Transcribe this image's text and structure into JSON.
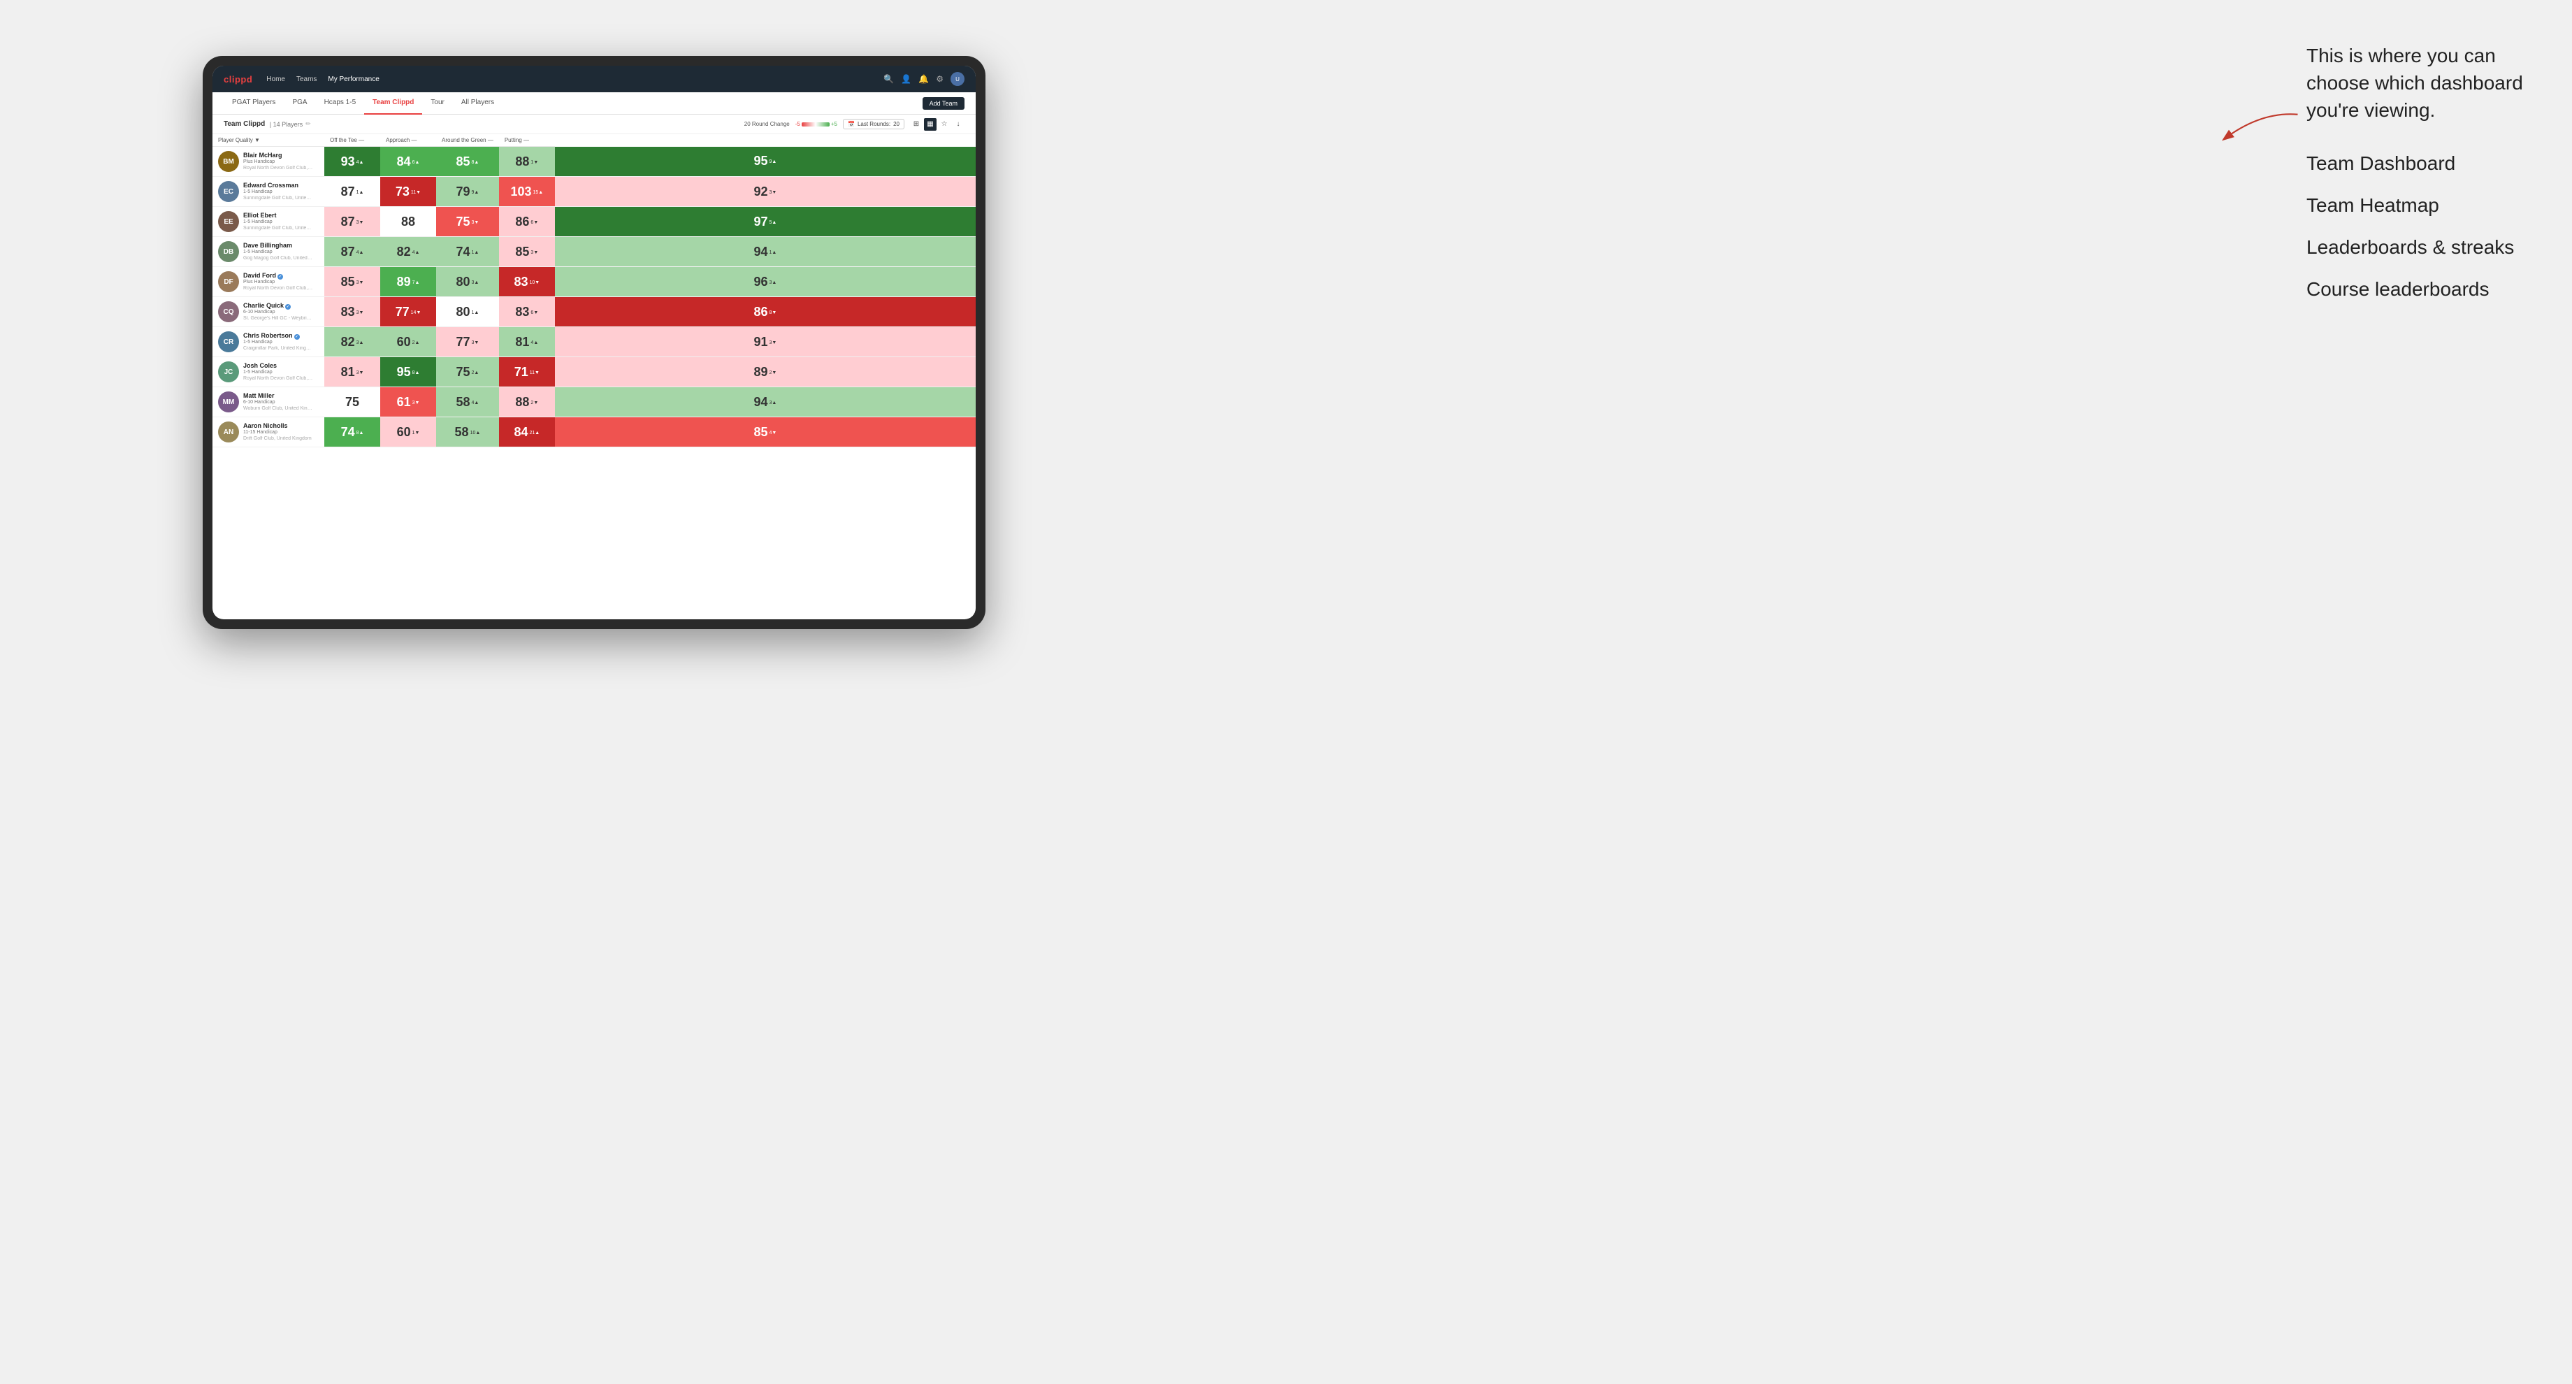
{
  "annotation": {
    "intro": "This is where you can choose which dashboard you're viewing.",
    "items": [
      "Team Dashboard",
      "Team Heatmap",
      "Leaderboards & streaks",
      "Course leaderboards"
    ]
  },
  "nav": {
    "logo": "clippd",
    "links": [
      "Home",
      "Teams",
      "My Performance"
    ],
    "active_link": "My Performance"
  },
  "tabs": {
    "items": [
      "PGAT Players",
      "PGA",
      "Hcaps 1-5",
      "Team Clippd",
      "Tour",
      "All Players"
    ],
    "active": "Team Clippd",
    "add_team_label": "Add Team"
  },
  "toolbar": {
    "team_name": "Team Clippd",
    "separator": "|",
    "player_count": "14 Players",
    "round_change_label": "20 Round Change",
    "scale_neg": "-5",
    "scale_pos": "+5",
    "last_rounds_label": "Last Rounds:",
    "last_rounds_value": "20"
  },
  "table": {
    "headers": {
      "player": "Player Quality ▼",
      "off_tee": "Off the Tee —",
      "approach": "Approach —",
      "around_green": "Around the Green —",
      "putting": "Putting —"
    },
    "rows": [
      {
        "name": "Blair McHarg",
        "handicap": "Plus Handicap",
        "club": "Royal North Devon Golf Club, United Kingdom",
        "avatar_color": "#8B6914",
        "initials": "BM",
        "scores": {
          "quality": {
            "val": 93,
            "change": "4▲",
            "bg": "green-dark"
          },
          "off_tee": {
            "val": 84,
            "change": "6▲",
            "bg": "green-med"
          },
          "approach": {
            "val": 85,
            "change": "8▲",
            "bg": "green-med"
          },
          "around": {
            "val": 88,
            "change": "1▼",
            "bg": "green-light"
          },
          "putting": {
            "val": 95,
            "change": "9▲",
            "bg": "green-dark"
          }
        }
      },
      {
        "name": "Edward Crossman",
        "handicap": "1-5 Handicap",
        "club": "Sunningdale Golf Club, United Kingdom",
        "avatar_color": "#5a7a9a",
        "initials": "EC",
        "scores": {
          "quality": {
            "val": 87,
            "change": "1▲",
            "bg": "white"
          },
          "off_tee": {
            "val": 73,
            "change": "11▼",
            "bg": "red-dark"
          },
          "approach": {
            "val": 79,
            "change": "9▲",
            "bg": "green-light"
          },
          "around": {
            "val": 103,
            "change": "15▲",
            "bg": "red-med"
          },
          "putting": {
            "val": 92,
            "change": "3▼",
            "bg": "red-light"
          }
        }
      },
      {
        "name": "Elliot Ebert",
        "handicap": "1-5 Handicap",
        "club": "Sunningdale Golf Club, United Kingdom",
        "avatar_color": "#7a5a4a",
        "initials": "EE",
        "scores": {
          "quality": {
            "val": 87,
            "change": "3▼",
            "bg": "red-light"
          },
          "off_tee": {
            "val": 88,
            "change": "",
            "bg": "white"
          },
          "approach": {
            "val": 75,
            "change": "3▼",
            "bg": "red-med"
          },
          "around": {
            "val": 86,
            "change": "6▼",
            "bg": "red-light"
          },
          "putting": {
            "val": 97,
            "change": "5▲",
            "bg": "green-dark"
          }
        }
      },
      {
        "name": "Dave Billingham",
        "handicap": "1-5 Handicap",
        "club": "Gog Magog Golf Club, United Kingdom",
        "avatar_color": "#6a8a6a",
        "initials": "DB",
        "scores": {
          "quality": {
            "val": 87,
            "change": "4▲",
            "bg": "green-light"
          },
          "off_tee": {
            "val": 82,
            "change": "4▲",
            "bg": "green-light"
          },
          "approach": {
            "val": 74,
            "change": "1▲",
            "bg": "green-light"
          },
          "around": {
            "val": 85,
            "change": "3▼",
            "bg": "red-light"
          },
          "putting": {
            "val": 94,
            "change": "1▲",
            "bg": "green-light"
          }
        }
      },
      {
        "name": "David Ford",
        "handicap": "Plus Handicap",
        "club": "Royal North Devon Golf Club, United Kingdom",
        "avatar_color": "#9a7a5a",
        "initials": "DF",
        "verified": true,
        "scores": {
          "quality": {
            "val": 85,
            "change": "3▼",
            "bg": "red-light"
          },
          "off_tee": {
            "val": 89,
            "change": "7▲",
            "bg": "green-med"
          },
          "approach": {
            "val": 80,
            "change": "3▲",
            "bg": "green-light"
          },
          "around": {
            "val": 83,
            "change": "10▼",
            "bg": "red-dark"
          },
          "putting": {
            "val": 96,
            "change": "3▲",
            "bg": "green-light"
          }
        }
      },
      {
        "name": "Charlie Quick",
        "handicap": "6-10 Handicap",
        "club": "St. George's Hill GC - Weybridge - Surrey, Uni...",
        "avatar_color": "#8a6a7a",
        "initials": "CQ",
        "verified": true,
        "scores": {
          "quality": {
            "val": 83,
            "change": "3▼",
            "bg": "red-light"
          },
          "off_tee": {
            "val": 77,
            "change": "14▼",
            "bg": "red-dark"
          },
          "approach": {
            "val": 80,
            "change": "1▲",
            "bg": "white"
          },
          "around": {
            "val": 83,
            "change": "6▼",
            "bg": "red-light"
          },
          "putting": {
            "val": 86,
            "change": "8▼",
            "bg": "red-dark"
          }
        }
      },
      {
        "name": "Chris Robertson",
        "handicap": "1-5 Handicap",
        "club": "Craigmillar Park, United Kingdom",
        "avatar_color": "#4a7a9a",
        "initials": "CR",
        "verified": true,
        "scores": {
          "quality": {
            "val": 82,
            "change": "3▲",
            "bg": "green-light"
          },
          "off_tee": {
            "val": 60,
            "change": "2▲",
            "bg": "green-light"
          },
          "approach": {
            "val": 77,
            "change": "3▼",
            "bg": "red-light"
          },
          "around": {
            "val": 81,
            "change": "4▲",
            "bg": "green-light"
          },
          "putting": {
            "val": 91,
            "change": "3▼",
            "bg": "red-light"
          }
        }
      },
      {
        "name": "Josh Coles",
        "handicap": "1-5 Handicap",
        "club": "Royal North Devon Golf Club, United Kingdom",
        "avatar_color": "#5a9a7a",
        "initials": "JC",
        "scores": {
          "quality": {
            "val": 81,
            "change": "3▼",
            "bg": "red-light"
          },
          "off_tee": {
            "val": 95,
            "change": "8▲",
            "bg": "green-dark"
          },
          "approach": {
            "val": 75,
            "change": "2▲",
            "bg": "green-light"
          },
          "around": {
            "val": 71,
            "change": "11▼",
            "bg": "red-dark"
          },
          "putting": {
            "val": 89,
            "change": "2▼",
            "bg": "red-light"
          }
        }
      },
      {
        "name": "Matt Miller",
        "handicap": "6-10 Handicap",
        "club": "Woburn Golf Club, United Kingdom",
        "avatar_color": "#7a5a8a",
        "initials": "MM",
        "scores": {
          "quality": {
            "val": 75,
            "change": "",
            "bg": "white"
          },
          "off_tee": {
            "val": 61,
            "change": "3▼",
            "bg": "red-med"
          },
          "approach": {
            "val": 58,
            "change": "4▲",
            "bg": "green-light"
          },
          "around": {
            "val": 88,
            "change": "2▼",
            "bg": "red-light"
          },
          "putting": {
            "val": 94,
            "change": "3▲",
            "bg": "green-light"
          }
        }
      },
      {
        "name": "Aaron Nicholls",
        "handicap": "11-15 Handicap",
        "club": "Drift Golf Club, United Kingdom",
        "avatar_color": "#9a8a5a",
        "initials": "AN",
        "scores": {
          "quality": {
            "val": 74,
            "change": "8▲",
            "bg": "green-med"
          },
          "off_tee": {
            "val": 60,
            "change": "1▼",
            "bg": "red-light"
          },
          "approach": {
            "val": 58,
            "change": "10▲",
            "bg": "green-light"
          },
          "around": {
            "val": 84,
            "change": "21▲",
            "bg": "red-dark"
          },
          "putting": {
            "val": 85,
            "change": "4▼",
            "bg": "red-med"
          }
        }
      }
    ]
  }
}
